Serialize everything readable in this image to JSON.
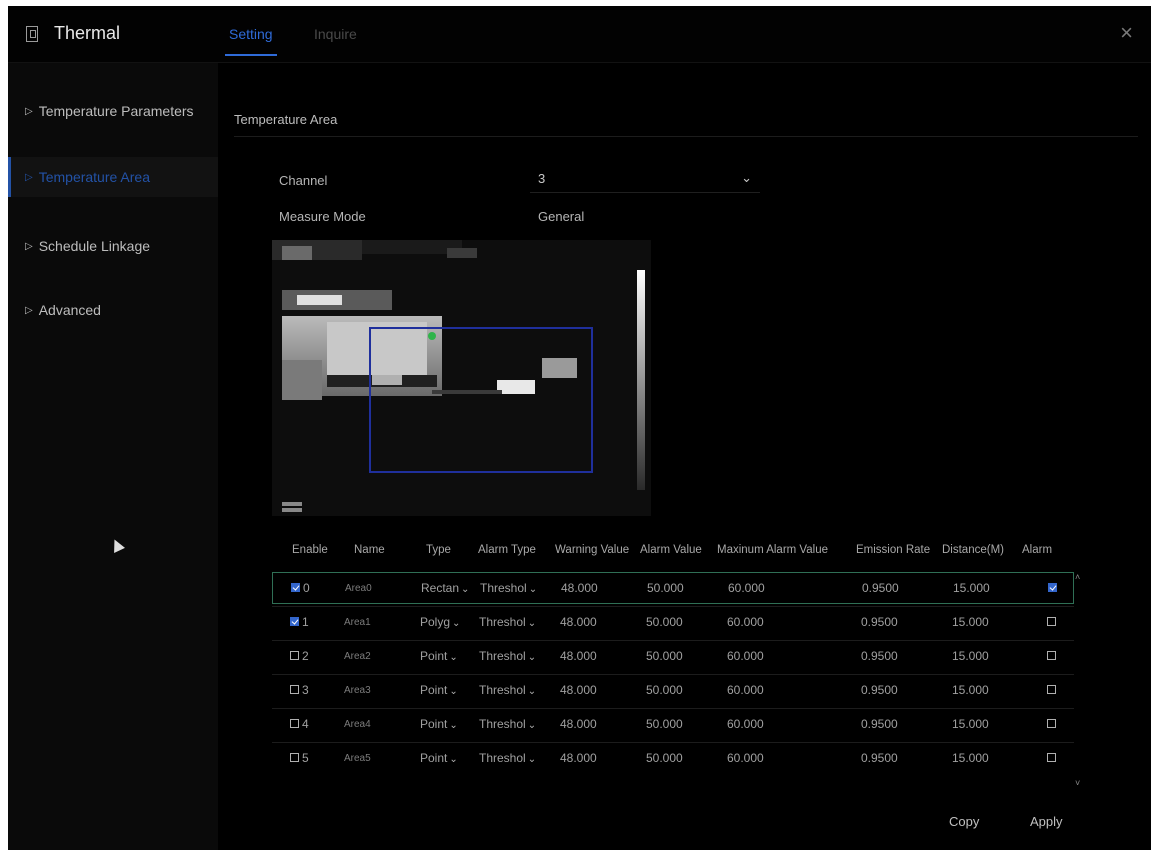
{
  "app": {
    "title": "Thermal"
  },
  "tabs": [
    {
      "label": "Setting"
    },
    {
      "label": "Inquire"
    }
  ],
  "close_label": "×",
  "sidebar": {
    "items": [
      {
        "label": "Temperature Parameters"
      },
      {
        "label": "Temperature Area",
        "active": true
      },
      {
        "label": "Schedule Linkage"
      },
      {
        "label": "Advanced"
      }
    ]
  },
  "section": {
    "title": "Temperature Area"
  },
  "form": {
    "channel_label": "Channel",
    "channel_value": "3",
    "measure_mode_label": "Measure Mode",
    "measure_mode_value": "General"
  },
  "table": {
    "headers": [
      "Enable",
      "Name",
      "Type",
      "Alarm Type",
      "Warning Value",
      "Alarm Value",
      "Maxinum Alarm Value",
      "Emission Rate",
      "Distance(M)",
      "Alarm"
    ],
    "rows": [
      {
        "enabled": true,
        "index": "0",
        "name": "Area0",
        "type": "Rectan",
        "alarm_type": "Threshol",
        "warning": "48.000",
        "alarm": "50.000",
        "max_alarm": "60.000",
        "emission": "0.9500",
        "distance": "15.000",
        "alarm_checked": true
      },
      {
        "enabled": true,
        "index": "1",
        "name": "Area1",
        "type": "Polyg",
        "alarm_type": "Threshol",
        "warning": "48.000",
        "alarm": "50.000",
        "max_alarm": "60.000",
        "emission": "0.9500",
        "distance": "15.000",
        "alarm_checked": false
      },
      {
        "enabled": false,
        "index": "2",
        "name": "Area2",
        "type": "Point",
        "alarm_type": "Threshol",
        "warning": "48.000",
        "alarm": "50.000",
        "max_alarm": "60.000",
        "emission": "0.9500",
        "distance": "15.000",
        "alarm_checked": false
      },
      {
        "enabled": false,
        "index": "3",
        "name": "Area3",
        "type": "Point",
        "alarm_type": "Threshol",
        "warning": "48.000",
        "alarm": "50.000",
        "max_alarm": "60.000",
        "emission": "0.9500",
        "distance": "15.000",
        "alarm_checked": false
      },
      {
        "enabled": false,
        "index": "4",
        "name": "Area4",
        "type": "Point",
        "alarm_type": "Threshol",
        "warning": "48.000",
        "alarm": "50.000",
        "max_alarm": "60.000",
        "emission": "0.9500",
        "distance": "15.000",
        "alarm_checked": false
      },
      {
        "enabled": false,
        "index": "5",
        "name": "Area5",
        "type": "Point",
        "alarm_type": "Threshol",
        "warning": "48.000",
        "alarm": "50.000",
        "max_alarm": "60.000",
        "emission": "0.9500",
        "distance": "15.000",
        "alarm_checked": false
      }
    ]
  },
  "buttons": {
    "copy": "Copy",
    "apply": "Apply"
  },
  "colors": {
    "accent": "#2f6bd8",
    "background": "#000000",
    "selected_row_border": "#2f6f55",
    "checkbox_on": "#3366cc"
  }
}
